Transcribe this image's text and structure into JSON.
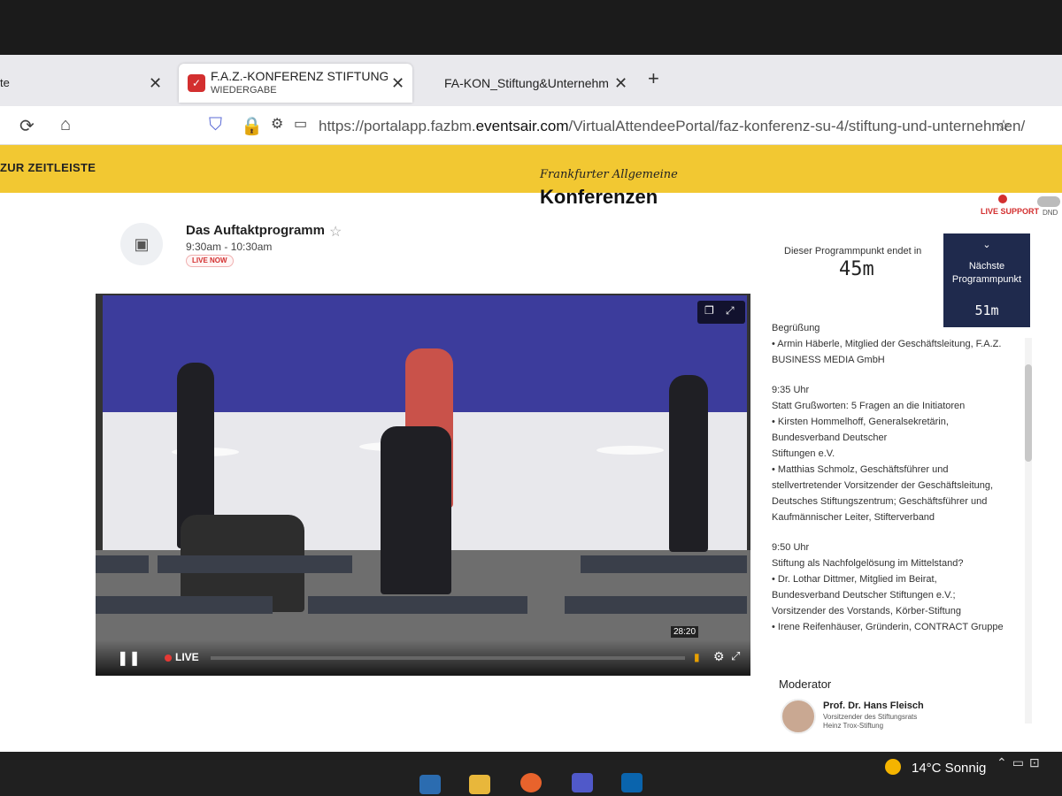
{
  "browser": {
    "tabs": [
      {
        "title": "te",
        "close": "✕"
      },
      {
        "title": "F.A.Z.-KONFERENZ STIFTUNG &",
        "subtitle": "WIEDERGABE",
        "close": "✕"
      },
      {
        "title": "FA-KON_Stiftung&Unternehmen",
        "close": "✕"
      }
    ],
    "new_tab": "+",
    "url_prefix": "https://portalapp.fazbm.",
    "url_domain": "eventsair.com",
    "url_path": "/VirtualAttendeePortal/faz-konferenz-su-4/stiftung-und-unternehmen/"
  },
  "header": {
    "zeitleiste": "ZUR ZEITLEISTE",
    "brand_top": "Frankfurter Allgemeine",
    "brand_main": "Konferenzen",
    "live_support": "LIVE SUPPORT",
    "dnd": "DND"
  },
  "session": {
    "title": "Das Auftaktprogramm",
    "time": "9:30am - 10:30am",
    "live_badge": "LIVE NOW"
  },
  "timer": {
    "ends_label": "Dieser Programmpunkt endet in",
    "ends_value": "45m",
    "next_label": "Nächste Programmpunkt",
    "next_value": "51m"
  },
  "video": {
    "live_label": "LIVE",
    "timestamp": "28:20"
  },
  "agenda": {
    "lines": [
      "Begrüßung",
      "• Armin Häberle, Mitglied der Geschäftsleitung, F.A.Z.",
      "BUSINESS MEDIA GmbH",
      "",
      "9:35 Uhr",
      "Statt Grußworten: 5 Fragen an die Initiatoren",
      "• Kirsten Hommelhoff, Generalsekretärin,",
      "Bundesverband Deutscher",
      "Stiftungen e.V.",
      "• Matthias Schmolz, Geschäftsführer und",
      "stellvertretender Vorsitzender der Geschäftsleitung,",
      "Deutsches Stiftungszentrum; Geschäftsführer und",
      "Kaufmännischer Leiter, Stifterverband",
      "",
      "9:50 Uhr",
      "Stiftung als Nachfolgelösung im Mittelstand?",
      "• Dr. Lothar Dittmer, Mitglied im Beirat,",
      "Bundesverband Deutscher Stiftungen e.V.;",
      "Vorsitzender des Vorstands, Körber-Stiftung",
      "• Irene Reifenhäuser, Gründerin, CONTRACT Gruppe"
    ],
    "moderator_label": "Moderator",
    "moderator_name": "Prof. Dr. Hans Fleisch",
    "moderator_role1": "Vorsitzender des Stiftungsrats",
    "moderator_role2": "Heinz Trox-Stiftung"
  },
  "taskbar": {
    "weather": "14°C  Sonnig"
  },
  "colors": {
    "accent_yellow": "#f2c832",
    "next_box": "#1f2a4d",
    "live_red": "#d32f2f"
  }
}
